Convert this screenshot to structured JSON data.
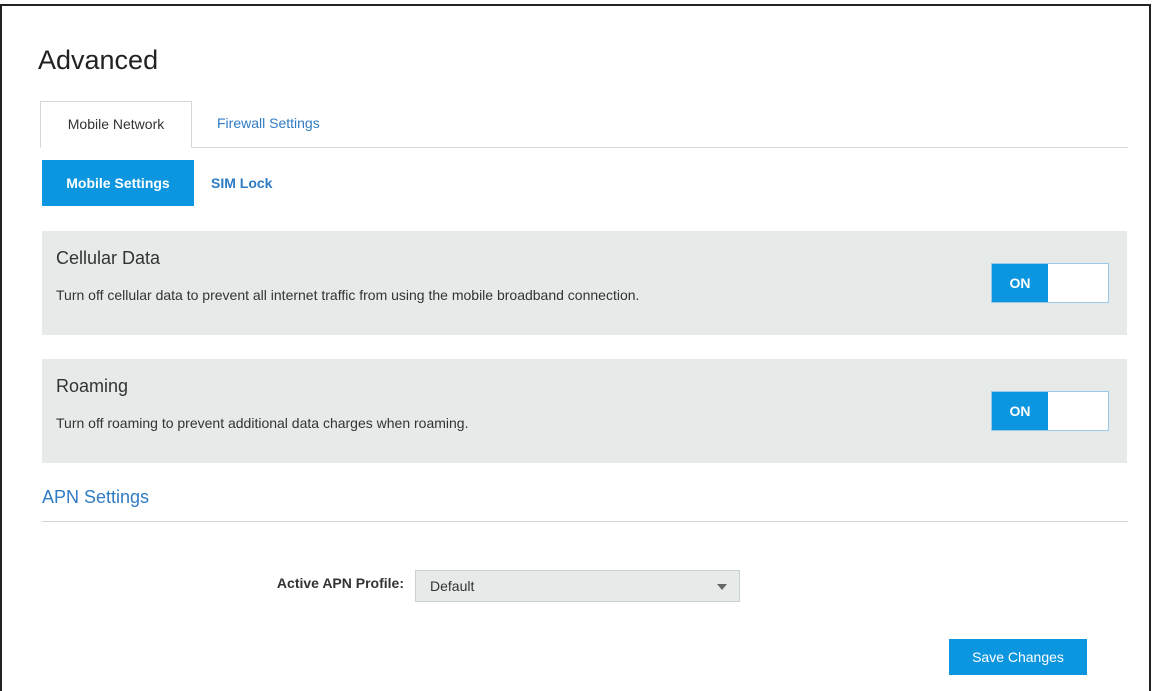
{
  "page": {
    "title": "Advanced"
  },
  "tabs": {
    "active": "Mobile Network",
    "inactive": "Firewall Settings"
  },
  "subnav": {
    "active": "Mobile Settings",
    "link": "SIM Lock"
  },
  "cellular": {
    "title": "Cellular Data",
    "description": "Turn off cellular data to prevent all internet traffic from using the mobile broadband connection.",
    "toggle_label": "ON",
    "state": true
  },
  "roaming": {
    "title": "Roaming",
    "description": "Turn off roaming to prevent additional data charges when roaming.",
    "toggle_label": "ON",
    "state": true
  },
  "apn": {
    "section_title": "APN Settings",
    "profile_label": "Active APN Profile:",
    "profile_value": "Default"
  },
  "actions": {
    "save_label": "Save Changes"
  },
  "colors": {
    "accent": "#0d96e0",
    "link": "#2f7bc4",
    "card_bg": "#e6ebea"
  }
}
